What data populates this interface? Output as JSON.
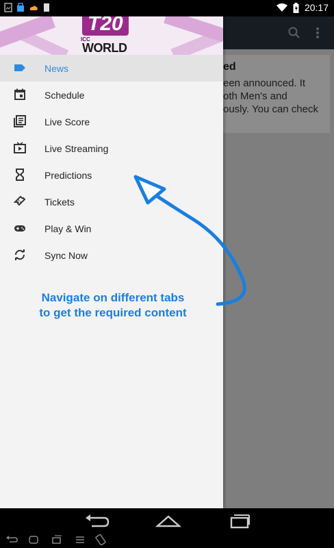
{
  "status_bar": {
    "time": "20:17",
    "left_icons": [
      "image-icon",
      "bag-icon",
      "cloud-icon",
      "sd-card-icon"
    ],
    "right_icons": [
      "wifi-icon",
      "battery-icon"
    ]
  },
  "header": {
    "logo_t20": "T20",
    "logo_icc": "ICC",
    "logo_world": "WORLD"
  },
  "menu": {
    "items": [
      {
        "label": "News",
        "icon": "label-icon",
        "active": true
      },
      {
        "label": "Schedule",
        "icon": "calendar-icon",
        "active": false
      },
      {
        "label": "Live Score",
        "icon": "newspaper-icon",
        "active": false
      },
      {
        "label": "Live Streaming",
        "icon": "video-icon",
        "active": false
      },
      {
        "label": "Predictions",
        "icon": "hourglass-icon",
        "active": false
      },
      {
        "label": "Tickets",
        "icon": "ticket-icon",
        "active": false
      },
      {
        "label": "Play & Win",
        "icon": "gamepad-icon",
        "active": false
      },
      {
        "label": "Sync Now",
        "icon": "sync-icon",
        "active": false
      }
    ]
  },
  "background_card": {
    "title": "ed",
    "lines": [
      "een announced. It",
      "oth Men's and",
      "ously. You can check"
    ]
  },
  "annotation": {
    "line1": "Navigate on different tabs",
    "line2": "to get the required content"
  },
  "colors": {
    "accent": "#2a8ce0",
    "annotation": "#1a7fe0",
    "toolbar": "#29333f"
  }
}
